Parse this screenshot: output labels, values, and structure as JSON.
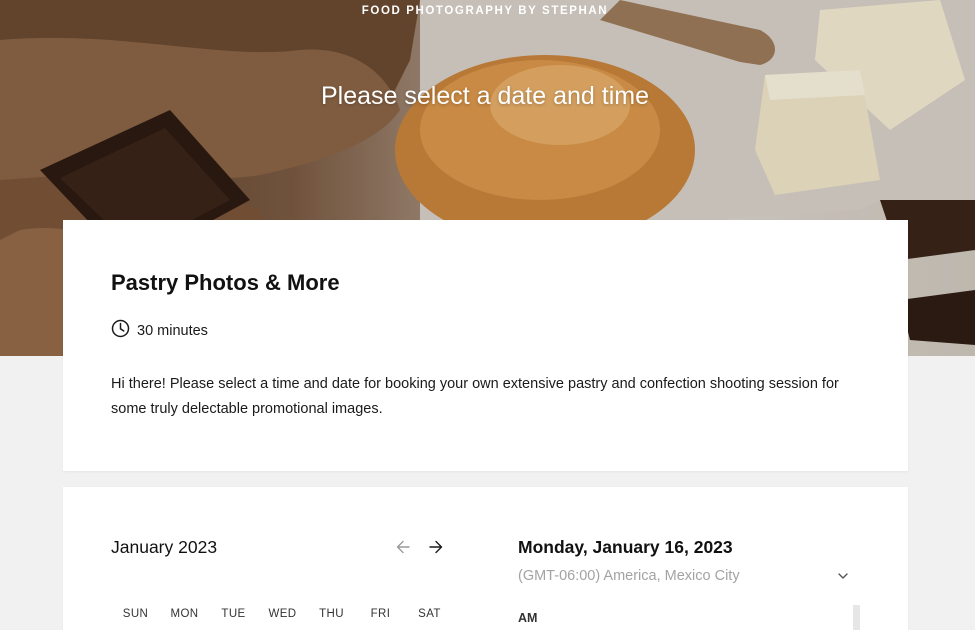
{
  "header": {
    "brand": "FOOD PHOTOGRAPHY BY STEPHAN",
    "title": "Please select a date and time"
  },
  "service": {
    "title": "Pastry Photos & More",
    "duration": "30 minutes",
    "description": "Hi there! Please select a time and date for booking your own extensive pastry and confection shooting session for some truly delectable promotional images."
  },
  "calendar": {
    "month": "January 2023",
    "weekdays": [
      "SUN",
      "MON",
      "TUE",
      "WED",
      "THU",
      "FRI",
      "SAT"
    ],
    "prev_icon": "arrow-left-icon",
    "next_icon": "arrow-right-icon"
  },
  "schedule": {
    "selected_date": "Monday, January 16, 2023",
    "timezone": "(GMT-06:00) America, Mexico City",
    "period_label": "AM"
  },
  "colors": {
    "background": "#f1f1f1",
    "card": "#ffffff",
    "muted_text": "#a3a3a3"
  }
}
